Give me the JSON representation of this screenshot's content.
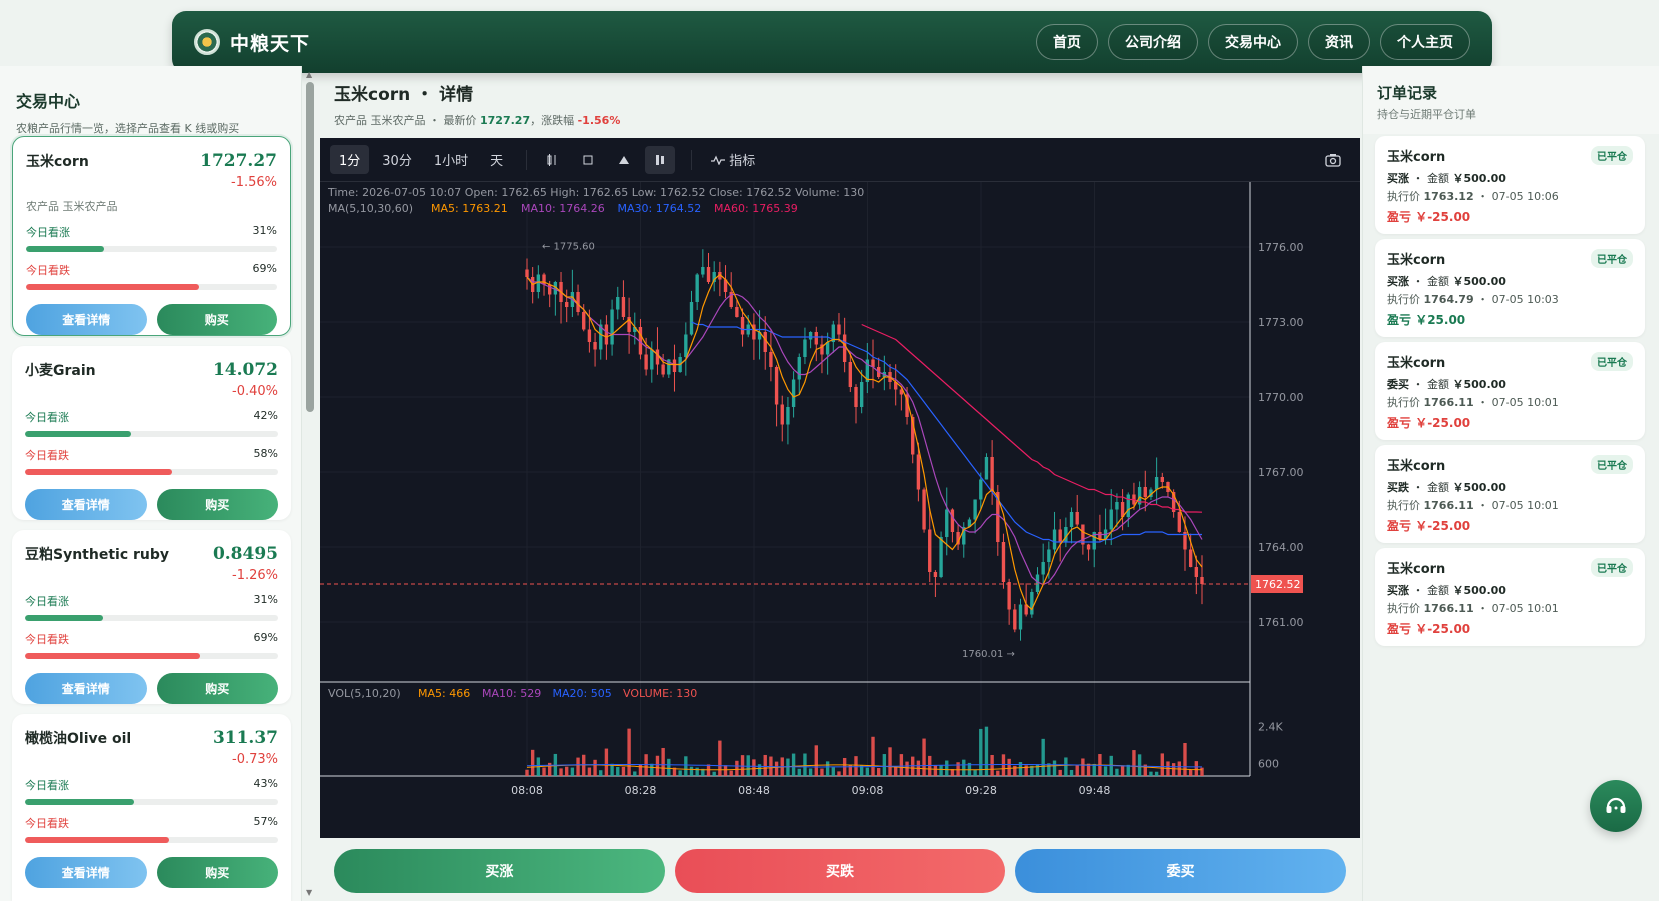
{
  "header": {
    "brand": "中粮天下",
    "nav": [
      "首页",
      "公司介绍",
      "交易中心",
      "资讯",
      "个人主页"
    ]
  },
  "sidebar": {
    "title": "交易中心",
    "subtitle": "农粮产品行情一览，选择产品查看 K 线或购买",
    "up_label": "今日看涨",
    "down_label": "今日看跌",
    "detail_label": "查看详情",
    "buy_label": "购买",
    "products": [
      {
        "name": "玉米corn",
        "price": "1727.27",
        "change": "-1.56%",
        "category": "农产品 玉米农产品",
        "up_pct": "31%",
        "down_pct": "69%",
        "up": 0.31,
        "down": 0.69
      },
      {
        "name": "小麦Grain",
        "price": "14.072",
        "change": "-0.40%",
        "category": "",
        "up_pct": "42%",
        "down_pct": "58%",
        "up": 0.42,
        "down": 0.58
      },
      {
        "name": "豆粕Synthetic ruby",
        "price": "0.8495",
        "change": "-1.26%",
        "category": "",
        "up_pct": "31%",
        "down_pct": "69%",
        "up": 0.31,
        "down": 0.69
      },
      {
        "name": "橄榄油Olive oil",
        "price": "311.37",
        "change": "-0.73%",
        "category": "",
        "up_pct": "43%",
        "down_pct": "57%",
        "up": 0.43,
        "down": 0.57
      }
    ]
  },
  "detail": {
    "title": "玉米corn ・ 详情",
    "sub_prefix": "农产品 玉米农产品 ・ 最新价",
    "latest": "1727.27",
    "sub_mid": "，涨跌幅",
    "change": "-1.56%"
  },
  "chart_toolbar": {
    "intervals": [
      "1分",
      "30分",
      "1小时",
      "天"
    ],
    "active_interval": "1分",
    "indicator_label": "指标"
  },
  "chart_data": {
    "type": "candlestick",
    "info_line": "Time: 2026-07-05 10:07    Open: 1762.65    High: 1762.65    Low: 1762.52    Close: 1762.52    Volume: 130",
    "ma_legend": [
      {
        "text": "MA(5,10,30,60)",
        "color": "#9598a1"
      },
      {
        "text": "MA5: 1763.21",
        "color": "#ff9800"
      },
      {
        "text": "MA10: 1764.26",
        "color": "#ab47bc"
      },
      {
        "text": "MA30: 1764.52",
        "color": "#2962ff"
      },
      {
        "text": "MA60: 1765.39",
        "color": "#e91e63"
      }
    ],
    "vol_legend": [
      {
        "text": "VOL(5,10,20)",
        "color": "#9598a1"
      },
      {
        "text": "MA5: 466",
        "color": "#ff9800"
      },
      {
        "text": "MA10: 529",
        "color": "#ab47bc"
      },
      {
        "text": "MA20: 505",
        "color": "#2962ff"
      },
      {
        "text": "VOLUME: 130",
        "color": "#ef5350"
      }
    ],
    "y_ticks": [
      "1776.00",
      "1773.00",
      "1770.00",
      "1767.00",
      "1764.00",
      "1761.00"
    ],
    "y_tick_values": [
      1776,
      1773,
      1770,
      1767,
      1764,
      1761
    ],
    "ylim": [
      1758.6,
      1778.6
    ],
    "vol_ticks": [
      "2.4K",
      "600"
    ],
    "vol_tick_values": [
      2400,
      600
    ],
    "vol_max": 3600,
    "x_ticks": [
      "08:08",
      "08:28",
      "08:48",
      "09:08",
      "09:28",
      "09:48"
    ],
    "last_price_label": "1762.52",
    "last_price": 1762.52,
    "high_marker": "1775.60",
    "low_marker": "1760.01",
    "close_path": [
      1774.8,
      1774.2,
      1774.9,
      1774.5,
      1774.1,
      1774.6,
      1773.8,
      1773.6,
      1774.2,
      1773.4,
      1772.7,
      1772.2,
      1771.9,
      1772.9,
      1772.1,
      1773.5,
      1774.0,
      1773.2,
      1772.6,
      1772.8,
      1771.7,
      1771.1,
      1771.9,
      1771.3,
      1770.9,
      1771.5,
      1771.0,
      1771.6,
      1772.5,
      1773.8,
      1774.9,
      1775.2,
      1774.6,
      1775.0,
      1774.7,
      1774.2,
      1773.6,
      1773.2,
      1772.5,
      1772.9,
      1772.3,
      1772.6,
      1771.8,
      1771.2,
      1769.7,
      1768.9,
      1769.6,
      1770.7,
      1771.6,
      1772.3,
      1772.6,
      1772.1,
      1771.7,
      1772.2,
      1772.9,
      1772.5,
      1771.4,
      1770.4,
      1769.6,
      1770.6,
      1771.5,
      1771.2,
      1770.8,
      1771.0,
      1770.6,
      1770.3,
      1770.1,
      1769.2,
      1767.7,
      1766.3,
      1764.7,
      1763.0,
      1762.8,
      1764.4,
      1765.5,
      1764.6,
      1764.1,
      1764.8,
      1765.1,
      1765.9,
      1766.7,
      1767.6,
      1766.2,
      1764.2,
      1762.6,
      1761.5,
      1760.7,
      1761.7,
      1761.3,
      1762.2,
      1762.9,
      1763.4,
      1763.9,
      1764.7,
      1764.2,
      1764.8,
      1765.4,
      1764.9,
      1764.1,
      1763.9,
      1764.6,
      1764.3,
      1764.7,
      1765.5,
      1765.8,
      1765.2,
      1766.1,
      1765.7,
      1766.4,
      1766.0,
      1766.3,
      1766.8,
      1766.6,
      1766.2,
      1765.4,
      1764.6,
      1763.9,
      1763.2,
      1762.8,
      1762.52
    ],
    "ma5_path": [
      1774.8,
      1774.5,
      1774.6,
      1774.6,
      1774.5,
      1774.4,
      1774.2,
      1774.0,
      1774.0,
      1773.7,
      1773.5,
      1773.2,
      1772.7,
      1772.5,
      1772.4,
      1772.5,
      1772.7,
      1772.9,
      1773.1,
      1772.8,
      1772.5,
      1772.1,
      1771.9,
      1771.7,
      1771.4,
      1771.3,
      1771.3,
      1771.3,
      1771.5,
      1772.1,
      1772.7,
      1773.6,
      1774.2,
      1774.7,
      1774.9,
      1774.7,
      1774.4,
      1773.9,
      1773.4,
      1773.1,
      1772.7,
      1772.6,
      1772.3,
      1772.0,
      1771.5,
      1770.8,
      1770.3,
      1770.0,
      1770.1,
      1770.6,
      1771.4,
      1771.9,
      1772.0,
      1772.2,
      1772.3,
      1772.3,
      1772.1,
      1771.7,
      1771.2,
      1770.9,
      1770.7,
      1770.7,
      1770.6,
      1770.8,
      1770.8,
      1770.6,
      1770.4,
      1769.9,
      1769.0,
      1768.0,
      1766.9,
      1765.5,
      1764.5,
      1764.3,
      1764.1,
      1763.9,
      1764.2,
      1764.7,
      1764.8,
      1765.0,
      1765.5,
      1766.1,
      1766.3,
      1766.0,
      1765.3,
      1764.2,
      1763.1,
      1762.3,
      1761.7,
      1761.5,
      1762.0,
      1762.5,
      1763.0,
      1763.7,
      1764.1,
      1764.4,
      1764.7,
      1764.8,
      1764.6,
      1764.5,
      1764.4,
      1764.3,
      1764.3,
      1764.6,
      1764.9,
      1765.2,
      1765.5,
      1765.6,
      1766.0,
      1765.9,
      1766.1,
      1766.3,
      1766.4,
      1766.4,
      1766.1,
      1765.6,
      1764.9,
      1764.2,
      1763.5,
      1763.2
    ],
    "ma10_path": [
      1774.8,
      1774.6,
      1774.6,
      1774.5,
      1774.4,
      1774.3,
      1774.2,
      1774.0,
      1773.9,
      1773.7,
      1773.5,
      1773.2,
      1773.0,
      1772.8,
      1772.6,
      1772.5,
      1772.5,
      1772.5,
      1772.5,
      1772.4,
      1772.2,
      1772.0,
      1771.9,
      1771.7,
      1771.5,
      1771.4,
      1771.3,
      1771.3,
      1771.5,
      1771.8,
      1772.1,
      1772.4,
      1772.8,
      1773.2,
      1773.6,
      1773.9,
      1774.1,
      1774.1,
      1774.0,
      1773.8,
      1773.5,
      1773.2,
      1773.0,
      1772.7,
      1772.3,
      1771.8,
      1771.4,
      1771.1,
      1770.9,
      1770.9,
      1771.0,
      1771.2,
      1771.4,
      1771.6,
      1771.8,
      1772.0,
      1772.0,
      1771.8,
      1771.6,
      1771.5,
      1771.3,
      1771.2,
      1771.0,
      1770.9,
      1770.8,
      1770.7,
      1770.5,
      1770.2,
      1769.8,
      1769.2,
      1768.4,
      1767.6,
      1766.8,
      1766.1,
      1765.6,
      1765.2,
      1764.9,
      1764.7,
      1764.6,
      1764.6,
      1764.8,
      1765.1,
      1765.3,
      1765.3,
      1765.1,
      1764.8,
      1764.4,
      1763.8,
      1763.3,
      1762.8,
      1762.6,
      1762.5,
      1762.6,
      1762.9,
      1763.3,
      1763.7,
      1764.0,
      1764.2,
      1764.3,
      1764.4,
      1764.5,
      1764.5,
      1764.5,
      1764.6,
      1764.7,
      1764.9,
      1765.1,
      1765.3,
      1765.5,
      1765.6,
      1765.8,
      1765.9,
      1766.0,
      1766.0,
      1765.9,
      1765.7,
      1765.4,
      1765.1,
      1764.7,
      1764.3
    ],
    "ma30_path": [
      null,
      null,
      null,
      null,
      null,
      null,
      null,
      null,
      null,
      null,
      null,
      null,
      null,
      null,
      null,
      null,
      null,
      null,
      null,
      null,
      null,
      null,
      null,
      null,
      null,
      null,
      null,
      null,
      null,
      1773.0,
      1772.9,
      1772.9,
      1772.8,
      1772.8,
      1772.8,
      1772.8,
      1772.8,
      1772.8,
      1772.7,
      1772.7,
      1772.7,
      1772.7,
      1772.7,
      1772.6,
      1772.5,
      1772.4,
      1772.4,
      1772.4,
      1772.4,
      1772.4,
      1772.4,
      1772.4,
      1772.4,
      1772.4,
      1772.3,
      1772.3,
      1772.2,
      1772.1,
      1772.0,
      1771.9,
      1771.8,
      1771.6,
      1771.5,
      1771.4,
      1771.2,
      1771.1,
      1770.9,
      1770.7,
      1770.4,
      1770.1,
      1769.8,
      1769.5,
      1769.2,
      1768.9,
      1768.6,
      1768.3,
      1768.0,
      1767.7,
      1767.4,
      1767.1,
      1766.8,
      1766.5,
      1766.2,
      1765.9,
      1765.6,
      1765.3,
      1765.0,
      1764.8,
      1764.6,
      1764.5,
      1764.4,
      1764.3,
      1764.3,
      1764.2,
      1764.2,
      1764.2,
      1764.2,
      1764.2,
      1764.2,
      1764.2,
      1764.2,
      1764.2,
      1764.3,
      1764.3,
      1764.4,
      1764.5,
      1764.5,
      1764.5,
      1764.5,
      1764.6,
      1764.6,
      1764.6,
      1764.6,
      1764.5,
      1764.5,
      1764.5,
      1764.5,
      1764.5,
      1764.5,
      1764.5
    ],
    "ma60_path": [
      null,
      null,
      null,
      null,
      null,
      null,
      null,
      null,
      null,
      null,
      null,
      null,
      null,
      null,
      null,
      null,
      null,
      null,
      null,
      null,
      null,
      null,
      null,
      null,
      null,
      null,
      null,
      null,
      null,
      null,
      null,
      null,
      null,
      null,
      null,
      null,
      null,
      null,
      null,
      null,
      null,
      null,
      null,
      null,
      null,
      null,
      null,
      null,
      null,
      null,
      null,
      null,
      null,
      null,
      null,
      null,
      null,
      null,
      null,
      1772.9,
      1772.8,
      1772.7,
      1772.6,
      1772.5,
      1772.4,
      1772.3,
      1772.1,
      1771.9,
      1771.7,
      1771.5,
      1771.3,
      1771.1,
      1770.9,
      1770.7,
      1770.5,
      1770.3,
      1770.1,
      1769.9,
      1769.7,
      1769.5,
      1769.3,
      1769.1,
      1768.9,
      1768.7,
      1768.5,
      1768.3,
      1768.1,
      1767.9,
      1767.7,
      1767.5,
      1767.4,
      1767.2,
      1767.1,
      1766.9,
      1766.8,
      1766.7,
      1766.6,
      1766.5,
      1766.4,
      1766.3,
      1766.3,
      1766.2,
      1766.1,
      1766.1,
      1766.0,
      1766.0,
      1765.9,
      1765.9,
      1765.8,
      1765.8,
      1765.7,
      1765.7,
      1765.6,
      1765.6,
      1765.5,
      1765.5,
      1765.4,
      1765.4,
      1765.4,
      1765.39
    ]
  },
  "actions": {
    "rise": "买涨",
    "fall": "买跌",
    "entrust": "委买"
  },
  "orders": {
    "title": "订单记录",
    "subtitle": "持仓与近期平仓订单",
    "items": [
      {
        "name": "玉米corn",
        "badge": "已平仓",
        "side": "买涨",
        "amount_label": "金额",
        "amount": "￥500.00",
        "price_label": "执行价",
        "price": "1763.12",
        "time": "07-05 10:06",
        "pnl_label": "盈亏",
        "pnl": "￥-25.00",
        "pnl_sign": "neg"
      },
      {
        "name": "玉米corn",
        "badge": "已平仓",
        "side": "买涨",
        "amount_label": "金额",
        "amount": "￥500.00",
        "price_label": "执行价",
        "price": "1764.79",
        "time": "07-05 10:03",
        "pnl_label": "盈亏",
        "pnl": "￥25.00",
        "pnl_sign": "pos"
      },
      {
        "name": "玉米corn",
        "badge": "已平仓",
        "side": "委买",
        "amount_label": "金额",
        "amount": "￥500.00",
        "price_label": "执行价",
        "price": "1766.11",
        "time": "07-05 10:01",
        "pnl_label": "盈亏",
        "pnl": "￥-25.00",
        "pnl_sign": "neg"
      },
      {
        "name": "玉米corn",
        "badge": "已平仓",
        "side": "买跌",
        "amount_label": "金额",
        "amount": "￥500.00",
        "price_label": "执行价",
        "price": "1766.11",
        "time": "07-05 10:01",
        "pnl_label": "盈亏",
        "pnl": "￥-25.00",
        "pnl_sign": "neg"
      },
      {
        "name": "玉米corn",
        "badge": "已平仓",
        "side": "买涨",
        "amount_label": "金额",
        "amount": "￥500.00",
        "price_label": "执行价",
        "price": "1766.11",
        "time": "07-05 10:01",
        "pnl_label": "盈亏",
        "pnl": "￥-25.00",
        "pnl_sign": "neg"
      }
    ]
  },
  "icons": {
    "support": "headset-icon",
    "screenshot": "camera-icon",
    "indicator": "wave-icon"
  }
}
